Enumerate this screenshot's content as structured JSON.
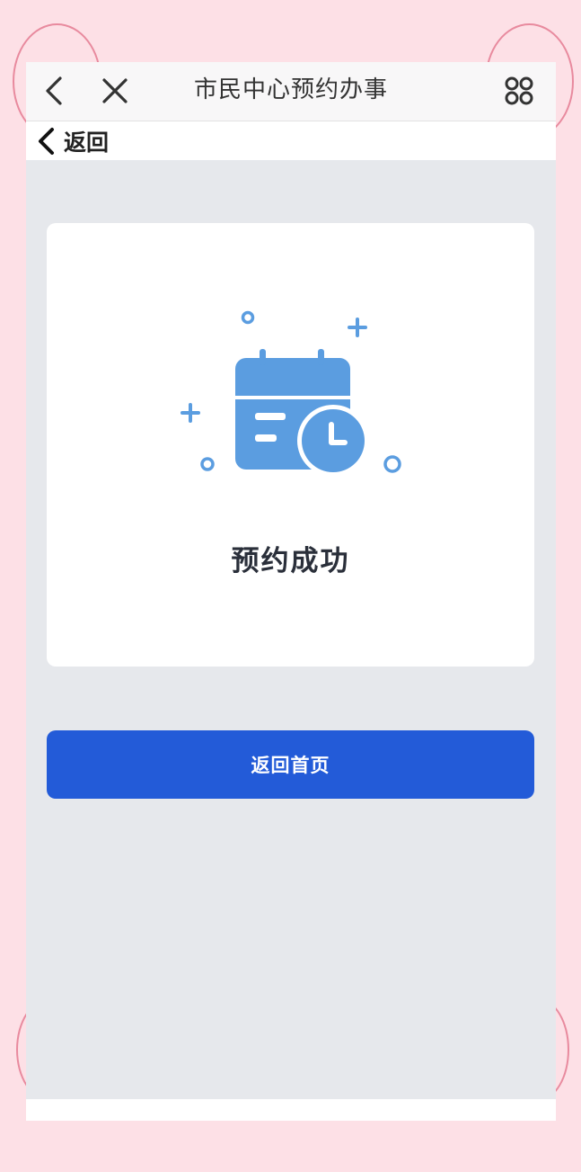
{
  "navbar": {
    "title": "市民中心预约办事",
    "back_icon": "chevron-left-icon",
    "close_icon": "close-icon",
    "more_icon": "command-icon"
  },
  "subbar": {
    "back_label": "返回"
  },
  "result": {
    "icon": "calendar-clock-icon",
    "message": "预约成功"
  },
  "actions": {
    "home_label": "返回首页"
  },
  "colors": {
    "primary": "#235bd8",
    "icon": "#5b9de0",
    "background": "#e6e8ec",
    "frame": "#fde0e6"
  }
}
